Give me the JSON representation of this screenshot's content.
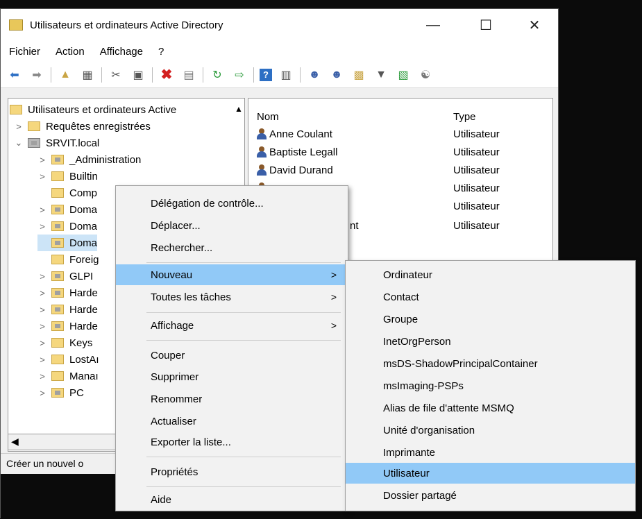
{
  "window": {
    "title": "Utilisateurs et ordinateurs Active Directory",
    "minimize": "—",
    "maximize": "☐",
    "close": "✕"
  },
  "menu": [
    "Fichier",
    "Action",
    "Affichage",
    "?"
  ],
  "tree": {
    "root": "Utilisateurs et ordinateurs Active",
    "items": [
      {
        "label": "Requêtes enregistrées",
        "chev": ">"
      },
      {
        "label": "SRVIT.local",
        "chev": "⌄"
      },
      {
        "label": "_Administration",
        "chev": ">"
      },
      {
        "label": "Builtin",
        "chev": ">"
      },
      {
        "label": "Comp",
        "chev": ""
      },
      {
        "label": "Doma",
        "chev": ">"
      },
      {
        "label": "Doma",
        "chev": ">"
      },
      {
        "label": "Doma",
        "chev": ""
      },
      {
        "label": "Foreig",
        "chev": ""
      },
      {
        "label": "GLPI",
        "chev": ">"
      },
      {
        "label": "Harde",
        "chev": ">"
      },
      {
        "label": "Harde",
        "chev": ">"
      },
      {
        "label": "Harde",
        "chev": ">"
      },
      {
        "label": "Keys",
        "chev": ">"
      },
      {
        "label": "LostAı",
        "chev": ">"
      },
      {
        "label": "Manaı",
        "chev": ">"
      },
      {
        "label": "PC",
        "chev": ">"
      }
    ]
  },
  "list": {
    "col_name": "Nom",
    "col_type": "Type",
    "rows": [
      {
        "name": "Anne Coulant",
        "type": "Utilisateur"
      },
      {
        "name": "Baptiste Legall",
        "type": "Utilisateur"
      },
      {
        "name": "David Durand",
        "type": "Utilisateur"
      },
      {
        "name": "",
        "type": "Utilisateur"
      },
      {
        "name": "",
        "type": "Utilisateur"
      },
      {
        "name": "nt",
        "type": "Utilisateur"
      }
    ]
  },
  "status": "Créer un nouvel o",
  "context_menu": {
    "delegation": "Délégation de contrôle...",
    "deplacer": "Déplacer...",
    "rechercher": "Rechercher...",
    "nouveau": "Nouveau",
    "toutes_taches": "Toutes les tâches",
    "affichage": "Affichage",
    "couper": "Couper",
    "supprimer": "Supprimer",
    "renommer": "Renommer",
    "actualiser": "Actualiser",
    "exporter": "Exporter la liste...",
    "proprietes": "Propriétés",
    "aide": "Aide",
    "submenu_arrow": ">"
  },
  "submenu": [
    "Ordinateur",
    "Contact",
    "Groupe",
    "InetOrgPerson",
    "msDS-ShadowPrincipalContainer",
    "msImaging-PSPs",
    "Alias de file d'attente MSMQ",
    "Unité d'organisation",
    "Imprimante",
    "Utilisateur",
    "Dossier partagé"
  ],
  "colors": {
    "highlight": "#91c9f7"
  },
  "icons": [
    "back-icon",
    "forward-icon",
    "up-folder-icon",
    "show-tree-icon",
    "cut-icon",
    "copy-icon",
    "delete-icon",
    "properties-icon",
    "refresh-icon",
    "export-icon",
    "help-icon",
    "console-icon",
    "new-user-icon",
    "new-group-icon",
    "new-ou-icon",
    "filter-icon",
    "add-to-group-icon",
    "delegate-icon"
  ]
}
